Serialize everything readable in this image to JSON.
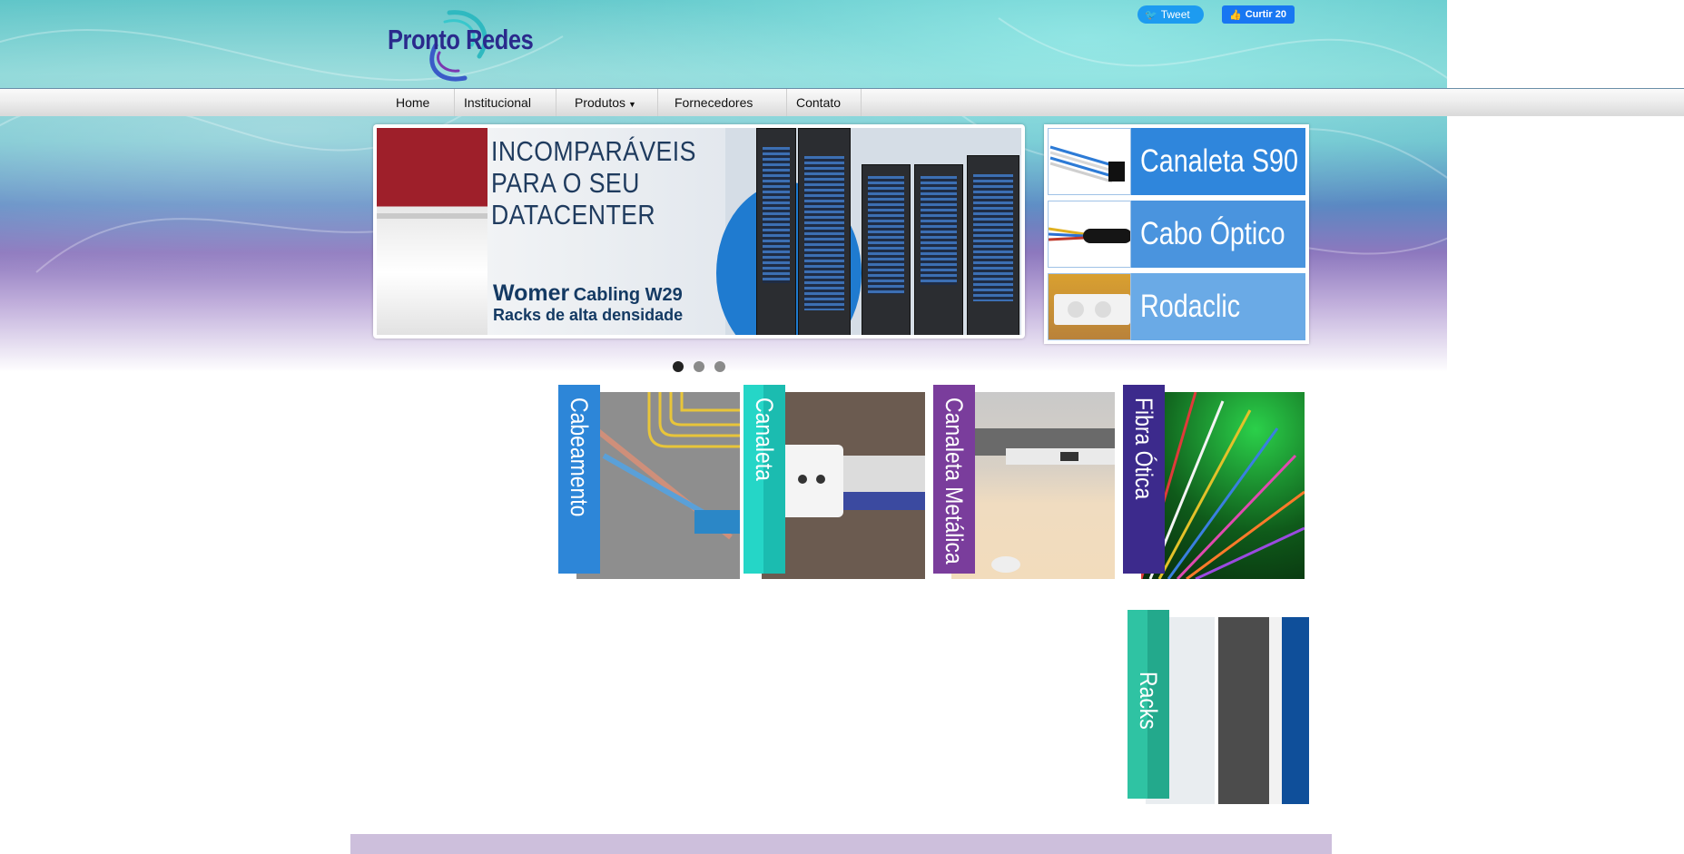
{
  "header": {
    "logo_text": "Pronto Redes",
    "tweet_label": "Tweet",
    "like_label": "Curtir 20"
  },
  "nav": {
    "items": [
      {
        "label": "Home"
      },
      {
        "label": "Institucional"
      },
      {
        "label": "Produtos",
        "has_dropdown": true
      },
      {
        "label": "Fornecedores"
      },
      {
        "label": "Contato"
      }
    ]
  },
  "slider": {
    "headline_lines": [
      "INCOMPARÁVEIS",
      "PARA O SEU",
      "DATACENTER"
    ],
    "brand": "Womer",
    "brand_product": "Cabling W29",
    "subtitle": "Racks de alta densidade",
    "slide_count": 3,
    "active_index": 0
  },
  "side_products": [
    {
      "label": "Canaleta S90",
      "color": "#2f86dc"
    },
    {
      "label": "Cabo Óptico",
      "color": "#4a94de"
    },
    {
      "label": "Rodaclic",
      "color": "#6aaae6"
    }
  ],
  "categories": [
    {
      "label": "Cabeamento",
      "color": "#2d86d8"
    },
    {
      "label": "Canaleta",
      "color": "#25d6c7"
    },
    {
      "label": "Canaleta Metálica",
      "color": "#7a3d9c"
    },
    {
      "label": "Fibra Ótica",
      "color": "#3c2a8c"
    },
    {
      "label": "Racks",
      "color": "#2fc3a3"
    }
  ],
  "colors": {
    "nav_text": "#111111",
    "logo_text": "#2a2a8c",
    "tweet": "#1d9bf0",
    "like": "#1877f2"
  }
}
